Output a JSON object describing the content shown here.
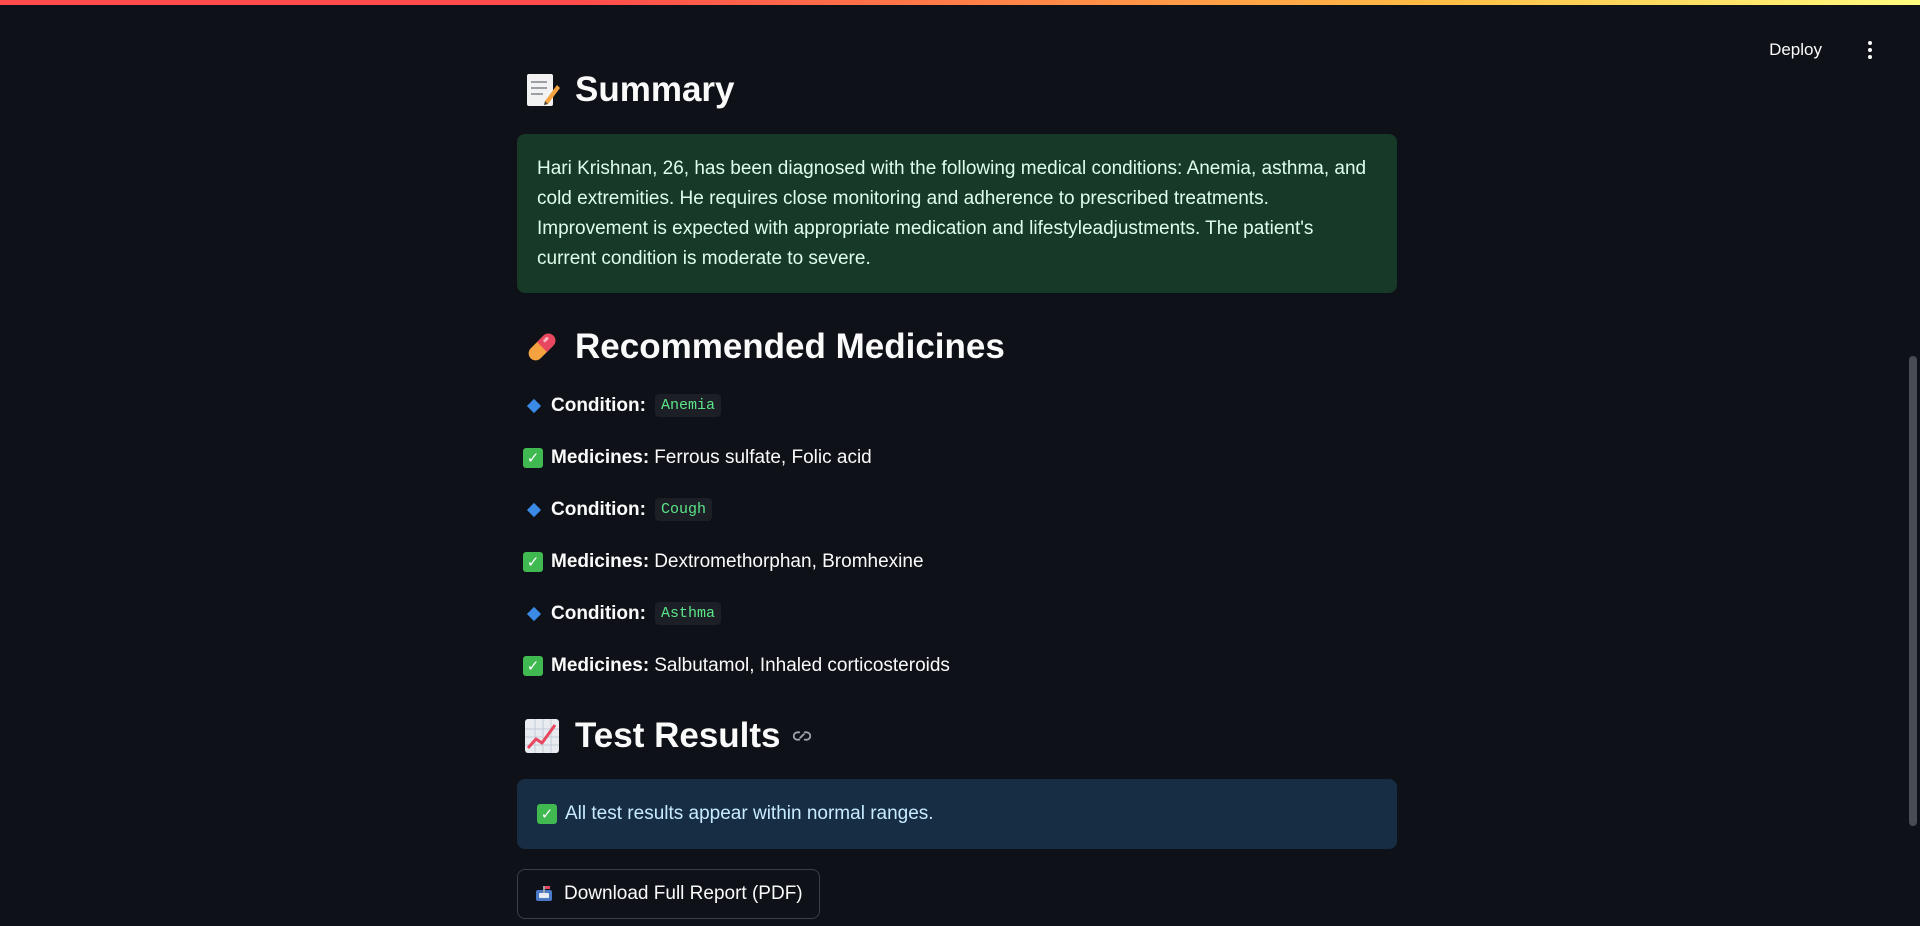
{
  "header": {
    "deploy_label": "Deploy"
  },
  "summary": {
    "icon": "memo-icon",
    "heading": "Summary",
    "text": "Hari Krishnan, 26, has been diagnosed with the following medical conditions: Anemia, asthma, and cold extremities. He requires close monitoring and adherence to prescribed treatments. Improvement is expected with appropriate medication and lifestyleadjustments. The patient's current condition is moderate to severe."
  },
  "medicines": {
    "icon": "pill-icon",
    "heading": "Recommended Medicines",
    "condition_label": "Condition:",
    "medicines_label": "Medicines:",
    "items": [
      {
        "condition": "Anemia",
        "medicines": "Ferrous sulfate, Folic acid"
      },
      {
        "condition": "Cough",
        "medicines": "Dextromethorphan, Bromhexine"
      },
      {
        "condition": "Asthma",
        "medicines": "Salbutamol, Inhaled corticosteroids"
      }
    ]
  },
  "tests": {
    "icon": "chart-increasing-icon",
    "heading": "Test Results",
    "message": "All test results appear within normal ranges."
  },
  "download": {
    "icon": "mailbox-icon",
    "label": "Download Full Report (PDF)"
  },
  "colors": {
    "background": "#0e1117",
    "success_box": "#173928",
    "info_box": "#172d43",
    "code_text": "#5ce488",
    "diamond": "#3b8ae6",
    "check": "#3fb950"
  }
}
